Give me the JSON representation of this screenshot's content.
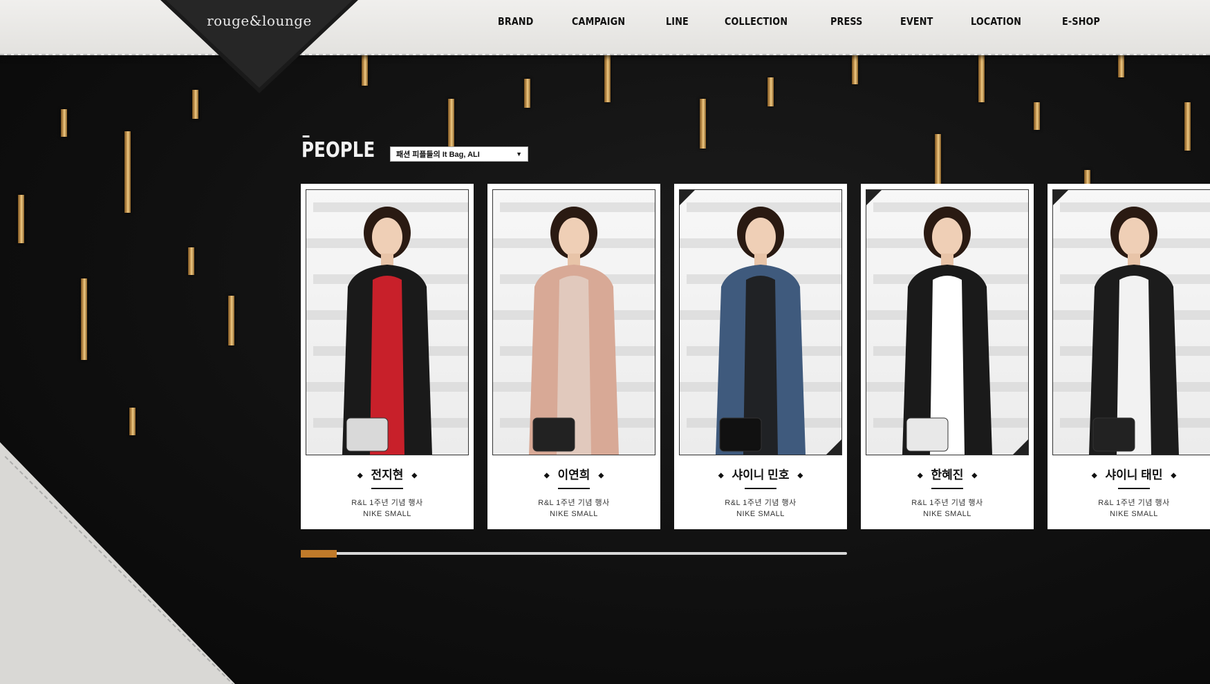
{
  "header": {
    "logo": "rouge&lounge",
    "nav": [
      "BRAND",
      "CAMPAIGN",
      "LINE",
      "COLLECTION",
      "PRESS",
      "EVENT",
      "LOCATION",
      "E-SHOP"
    ]
  },
  "section": {
    "title": "PEOPLE",
    "filter_value": "패션 피플들의 It Bag, ALI"
  },
  "cards": [
    {
      "name": "전지현",
      "line1": "R&L 1주년 기념 행사",
      "line2": "NIKE SMALL",
      "outfit": "#c8202a",
      "coat": "#1a1a1a",
      "bag": "#d9d9d9"
    },
    {
      "name": "이연희",
      "line1": "R&L 1주년 기념 행사",
      "line2": "NIKE SMALL",
      "outfit": "#e1c9bd",
      "coat": "#d8a996",
      "bag": "#222222"
    },
    {
      "name": "샤이니 민호",
      "line1": "R&L 1주년 기념 행사",
      "line2": "NIKE SMALL",
      "outfit": "#202225",
      "coat": "#3f5a7d",
      "bag": "#111111"
    },
    {
      "name": "한혜진",
      "line1": "R&L 1주년 기념 행사",
      "line2": "NIKE SMALL",
      "outfit": "#ffffff",
      "coat": "#1a1a1a",
      "bag": "#e8e8e8"
    },
    {
      "name": "샤이니 태민",
      "line1": "R&L 1주년 기념 행사",
      "line2": "NIKE SMALL",
      "outfit": "#f2f2f2",
      "coat": "#1c1c1c",
      "bag": "#222222"
    }
  ],
  "colors": {
    "accent": "#c07a2a",
    "gold": "#d9a860"
  },
  "scroll": {
    "position": 0.07
  }
}
